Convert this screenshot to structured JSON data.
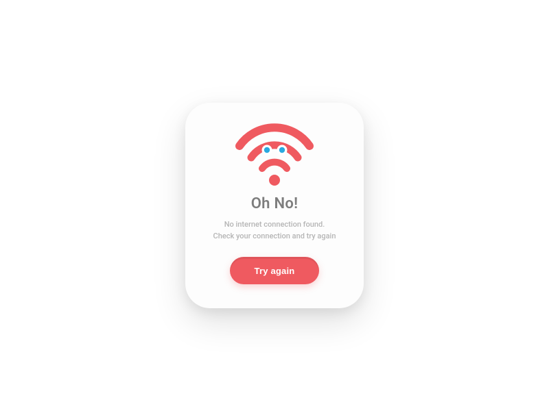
{
  "dialog": {
    "title": "Oh No!",
    "description_line1": "No internet connection found.",
    "description_line2": "Check your connection and try again",
    "button_label": "Try again"
  },
  "colors": {
    "accent": "#ef5a60",
    "eye": "#2aa9e0"
  }
}
